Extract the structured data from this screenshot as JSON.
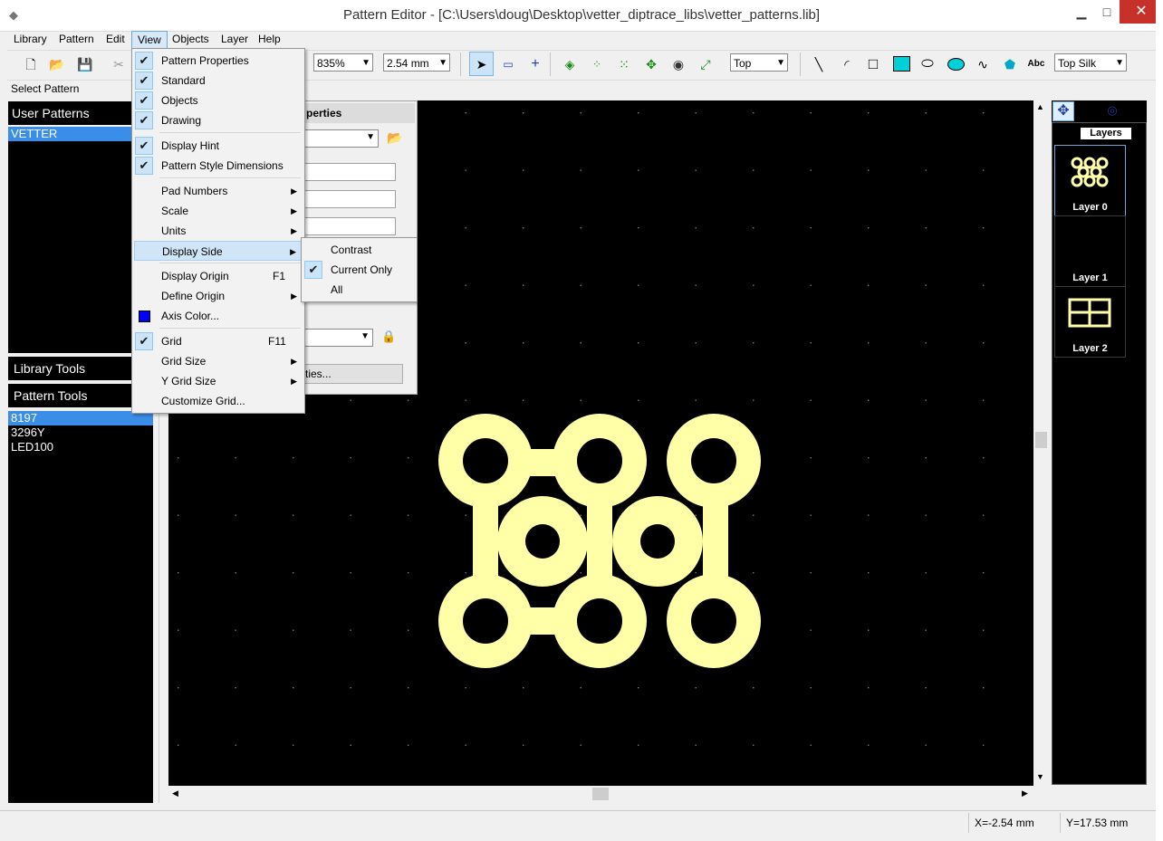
{
  "window": {
    "title": "Pattern Editor - [C:\\Users\\doug\\Desktop\\vetter_diptrace_libs\\vetter_patterns.lib]"
  },
  "menubar": [
    "Library",
    "Pattern",
    "Edit",
    "View",
    "Objects",
    "Layer",
    "Help"
  ],
  "toolbar": {
    "zoom": "835%",
    "grid": "2.54 mm",
    "side": "Top",
    "layer": "Top Silk",
    "text_tool": "Abc"
  },
  "left": {
    "select_label": "Select Pattern",
    "user_patterns_title": "User Patterns",
    "user_patterns": [
      "VETTER"
    ],
    "library_tools_title": "Library Tools",
    "pattern_tools_title": "Pattern Tools",
    "patterns": [
      "8197",
      "3296Y",
      "LED100"
    ]
  },
  "props": {
    "header_fragment": "perties",
    "button_fragment": "ties..."
  },
  "view_menu": {
    "items": [
      {
        "label": "Pattern Properties",
        "checked": true
      },
      {
        "label": "Standard",
        "checked": true
      },
      {
        "label": "Objects",
        "checked": true
      },
      {
        "label": "Drawing",
        "checked": true
      },
      {
        "label": "Display Hint",
        "checked": true
      },
      {
        "label": "Pattern Style Dimensions",
        "checked": true
      },
      {
        "label": "Pad Numbers"
      },
      {
        "label": "Scale"
      },
      {
        "label": "Units"
      },
      {
        "label": "Display Side"
      },
      {
        "label": "Display Origin",
        "key": "F1"
      },
      {
        "label": "Define Origin"
      },
      {
        "label": "Axis Color..."
      },
      {
        "label": "Grid",
        "key": "F11",
        "checked": true
      },
      {
        "label": "Grid Size"
      },
      {
        "label": "Y Grid Size"
      },
      {
        "label": "Customize Grid..."
      }
    ]
  },
  "display_side_menu": {
    "items": [
      "Contrast",
      "Current Only",
      "All"
    ],
    "checked": "Current Only"
  },
  "layers": {
    "title": "Layers",
    "items": [
      "Layer 0",
      "Layer 1",
      "Layer 2"
    ]
  },
  "status": {
    "x": "X=-2.54 mm",
    "y": "Y=17.53 mm"
  },
  "colors": {
    "pad": "#ffffa8",
    "canvas": "#000000",
    "selection": "#3b8ee8",
    "axis_color": "#0000ff"
  }
}
